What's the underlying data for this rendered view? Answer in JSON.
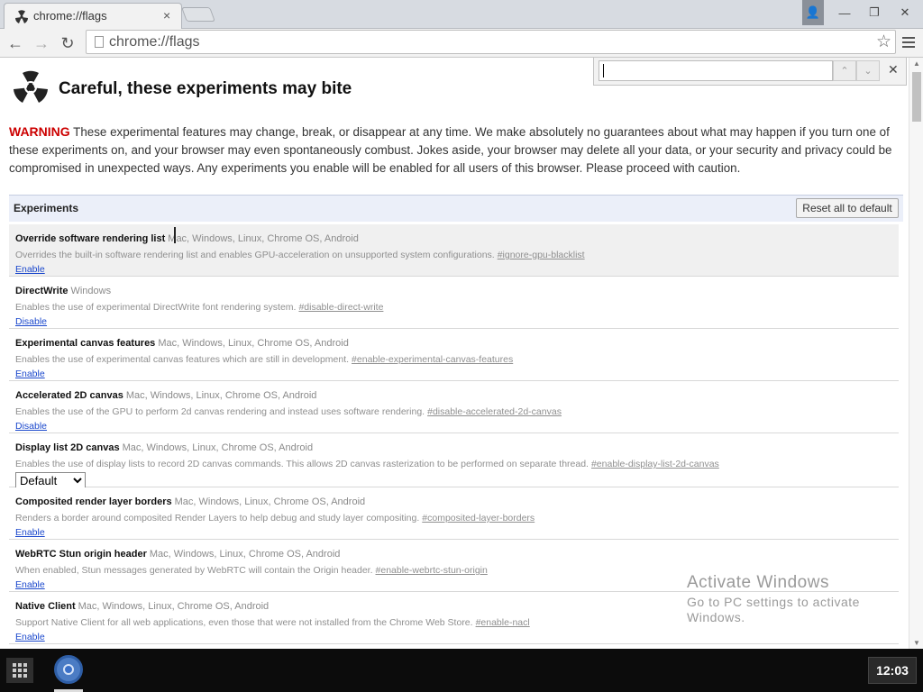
{
  "tab": {
    "title": "chrome://flags",
    "close_icon": "×"
  },
  "window": {
    "profile_icon": "👤",
    "minimize": "—",
    "restore": "❐",
    "close": "✕"
  },
  "toolbar": {
    "back": "←",
    "forward": "→",
    "reload": "↻",
    "url": "chrome://flags",
    "star": "☆"
  },
  "find": {
    "value": "",
    "prev": "⌃",
    "next": "⌄",
    "close": "✕"
  },
  "page": {
    "title": "Careful, these experiments may bite",
    "warning_label": "WARNING",
    "warning_text": " These experimental features may change, break, or disappear at any time. We make absolutely no guarantees about what may happen if you turn one of these experiments on, and your browser may even spontaneously combust. Jokes aside, your browser may delete all your data, or your security and privacy could be compromised in unexpected ways. Any experiments you enable will be enabled for all users of this browser. Please proceed with caution."
  },
  "experiments": {
    "header": "Experiments",
    "reset_label": "Reset all to default",
    "items": [
      {
        "name": "Override software rendering list",
        "platforms": "Mac, Windows, Linux, Chrome OS, Android",
        "description": "Overrides the built-in software rendering list and enables GPU-acceleration on unsupported system configurations.",
        "tag": "#ignore-gpu-blacklist",
        "action": "Enable"
      },
      {
        "name": "DirectWrite",
        "platforms": "Windows",
        "description": "Enables the use of experimental DirectWrite font rendering system.",
        "tag": "#disable-direct-write",
        "action": "Disable"
      },
      {
        "name": "Experimental canvas features",
        "platforms": "Mac, Windows, Linux, Chrome OS, Android",
        "description": "Enables the use of experimental canvas features which are still in development.",
        "tag": "#enable-experimental-canvas-features",
        "action": "Enable"
      },
      {
        "name": "Accelerated 2D canvas",
        "platforms": "Mac, Windows, Linux, Chrome OS, Android",
        "description": "Enables the use of the GPU to perform 2d canvas rendering and instead uses software rendering.",
        "tag": "#disable-accelerated-2d-canvas",
        "action": "Disable"
      },
      {
        "name": "Display list 2D canvas",
        "platforms": "Mac, Windows, Linux, Chrome OS, Android",
        "description": "Enables the use of display lists to record 2D canvas commands. This allows 2D canvas rasterization to be performed on separate thread.",
        "tag": "#enable-display-list-2d-canvas",
        "select_value": "Default"
      },
      {
        "name": "Composited render layer borders",
        "platforms": "Mac, Windows, Linux, Chrome OS, Android",
        "description": "Renders a border around composited Render Layers to help debug and study layer compositing.",
        "tag": "#composited-layer-borders",
        "action": "Enable"
      },
      {
        "name": "WebRTC Stun origin header",
        "platforms": "Mac, Windows, Linux, Chrome OS, Android",
        "description": "When enabled, Stun messages generated by WebRTC will contain the Origin header.",
        "tag": "#enable-webrtc-stun-origin",
        "action": "Enable"
      },
      {
        "name": "Native Client",
        "platforms": "Mac, Windows, Linux, Chrome OS, Android",
        "description": "Support Native Client for all web applications, even those that were not installed from the Chrome Web Store.",
        "tag": "#enable-nacl",
        "action": "Enable"
      }
    ]
  },
  "watermark": {
    "line1": "Activate Windows",
    "line2": "Go to PC settings to activate Windows."
  },
  "shelf": {
    "clock": "12:03"
  }
}
